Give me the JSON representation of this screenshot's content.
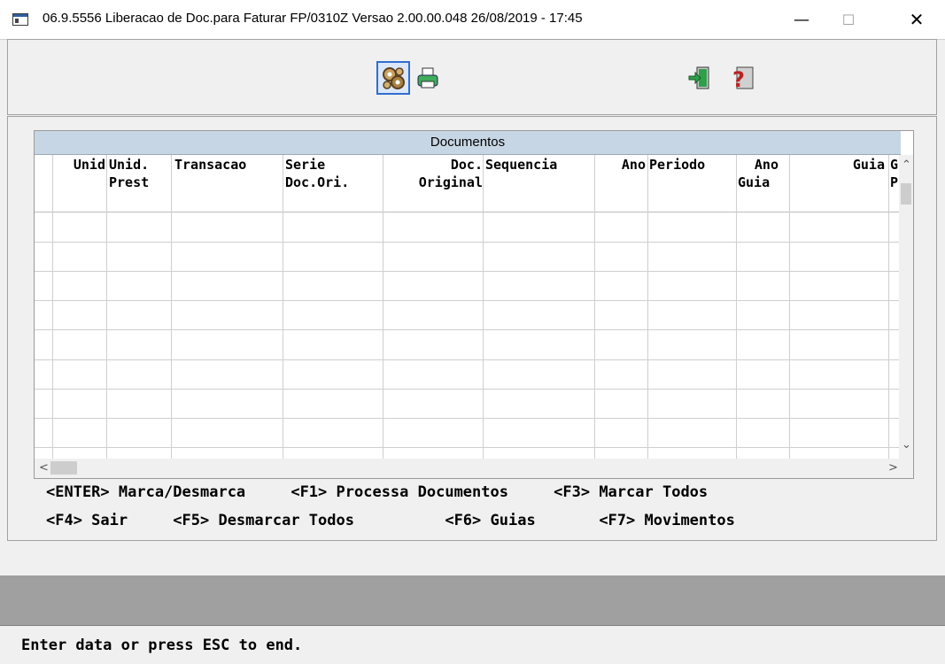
{
  "window": {
    "title": "06.9.5556   Liberacao de Doc.para Faturar FP/0310Z Versao 2.00.00.048 26/08/2019 - 17:45",
    "minimize": "—",
    "maximize": "☐",
    "close": "✕"
  },
  "toolbar": {
    "icons": [
      "process-gears-icon",
      "print-icon",
      "exit-door-icon",
      "help-icon"
    ]
  },
  "browse": {
    "title": "Documentos",
    "columns": [
      {
        "line1": "",
        "line2": "Unid"
      },
      {
        "line1": "Unid.",
        "line2": "Prest"
      },
      {
        "line1": "",
        "line2": "Transacao"
      },
      {
        "line1": "Serie",
        "line2": "Doc.Ori."
      },
      {
        "line1": "Doc.",
        "line2": "Original"
      },
      {
        "line1": "",
        "line2": "Sequencia"
      },
      {
        "line1": "",
        "line2": "Ano"
      },
      {
        "line1": "",
        "line2": "Periodo"
      },
      {
        "line1": "Ano",
        "line2": "Guia"
      },
      {
        "line1": "",
        "line2": "Guia"
      },
      {
        "line1": "G",
        "line2": "P"
      }
    ],
    "rows": []
  },
  "keys": {
    "line1": "<ENTER> Marca/Desmarca     <F1> Processa Documentos     <F3> Marcar Todos",
    "line2": "<F4> Sair     <F5> Desmarcar Todos          <F6> Guias       <F7> Movimentos"
  },
  "status": {
    "message": "Enter data or press ESC to end."
  }
}
